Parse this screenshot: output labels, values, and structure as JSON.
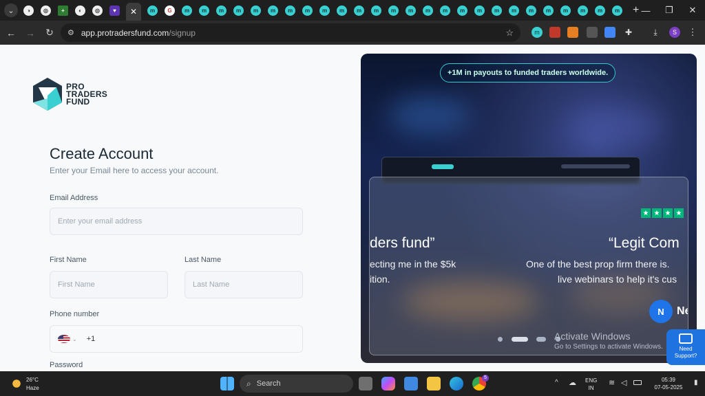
{
  "browser": {
    "url_host": "app.protradersfund.com",
    "url_path": "/signup",
    "active_tab_close": "✕",
    "new_tab": "+",
    "favicon_letter": "m",
    "ext_avatar": "S"
  },
  "logo": {
    "line1": "PRO",
    "line2": "TRADERS",
    "line3": "FUND"
  },
  "form": {
    "title": "Create Account",
    "subtitle": "Enter your Email here to access your account.",
    "email_label": "Email Address",
    "email_placeholder": "Enter your email address",
    "first_name_label": "First Name",
    "first_name_placeholder": "First Name",
    "last_name_label": "Last Name",
    "last_name_placeholder": "Last Name",
    "phone_label": "Phone number",
    "phone_code": "+1",
    "password_label": "Password"
  },
  "promo": {
    "pill": "+1M in payouts to funded traders worldwide.",
    "quote_left": "ders fund”",
    "left_line1": "ecting me in the $5k",
    "left_line2": "ition.",
    "quote_right": "“Legit Com",
    "right_line1": "One of the best prop firm there is.",
    "right_line2": "live webinars to help it's cus",
    "avatar_initial": "N",
    "avatar_name": "Net",
    "stars": [
      "★",
      "★",
      "★",
      "★"
    ]
  },
  "watermark": {
    "line1": "Activate Windows",
    "line2": "Go to Settings to activate Windows."
  },
  "support": {
    "line1": "Need",
    "line2": "Support?"
  },
  "taskbar": {
    "weather_temp": "26°C",
    "weather_desc": "Haze",
    "search": "Search",
    "lang1": "ENG",
    "lang2": "IN",
    "time": "05:39",
    "date": "07-05-2025",
    "chrome_badge": "5"
  },
  "colors": {
    "accent": "#33c9d0",
    "brand_dark": "#1c2b36",
    "trustpilot": "#00b67a",
    "support_blue": "#1f73e0"
  }
}
